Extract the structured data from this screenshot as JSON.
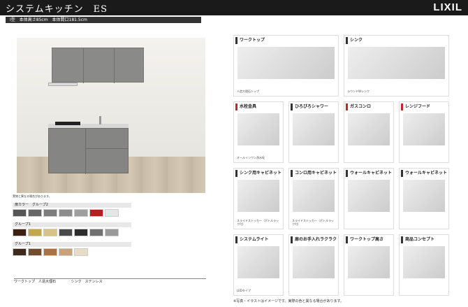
{
  "header": {
    "title": "システムキッチン　ES",
    "logo": "LIXIL"
  },
  "subheader": "I型　本体高さ85cm　本体間口181.5cm",
  "swatches": {
    "note": "実物と異なる場合があります。",
    "groups": [
      {
        "label": "扉カラー　グループ2",
        "colors": [
          "#555",
          "#666",
          "#7c7c7c",
          "#8d8d8d",
          "#9f9f9f",
          "#b11f1f",
          "#e6e6e6"
        ]
      },
      {
        "label": "グループ1",
        "colors": [
          "#3c1f10",
          "#c4a64c",
          "#d9c28a",
          "#494949",
          "#2c2c2c",
          "#707070",
          "#999"
        ]
      },
      {
        "label": "グループ1",
        "colors": [
          "#3d2a1d",
          "#754b2e",
          "#a77247",
          "#c9a27a",
          "#e8dcc9"
        ]
      }
    ]
  },
  "bottom": {
    "worktop": "ワークトップ　人造大理石",
    "sink": "シンク　ステンレス"
  },
  "cards": [
    {
      "title": "ワークトップ",
      "desc": "人造大理石トップ",
      "wide": true,
      "red": false
    },
    {
      "title": "シンク",
      "desc": "ラウンドWシンク",
      "wide": true,
      "red": false
    },
    {
      "title": "水栓金具",
      "desc": "オールインワン浄水栓",
      "wide": false,
      "red": true
    },
    {
      "title": "ひろびろシャワー",
      "desc": "",
      "wide": false,
      "red": false
    },
    {
      "title": "ガスコンロ",
      "desc": "",
      "wide": false,
      "red": true
    },
    {
      "title": "レンジフード",
      "desc": "",
      "wide": false,
      "red": true
    },
    {
      "title": "シンク用キャビネット",
      "desc": "スライドストッカー（ボトルラック付）",
      "wide": false,
      "red": false
    },
    {
      "title": "コンロ用キャビネット",
      "desc": "スライドストッカー（ボトルラック付）",
      "wide": false,
      "red": false
    },
    {
      "title": "ウォールキャビネット",
      "desc": "",
      "wide": false,
      "red": false
    },
    {
      "title": "ウォールキャビネット",
      "desc": "",
      "wide": false,
      "red": false
    },
    {
      "title": "システムライト",
      "desc": "LEDタイプ",
      "wide": false,
      "red": false
    },
    {
      "title": "扉のお手入れラクラク",
      "desc": "",
      "wide": false,
      "red": false
    },
    {
      "title": "ワークトップ高さ",
      "desc": "",
      "wide": false,
      "red": false
    },
    {
      "title": "商品コンセプト",
      "desc": "",
      "wide": false,
      "red": false
    }
  ],
  "footer": "※写真・イラストはイメージです。実際の色と異なる場合があります。"
}
